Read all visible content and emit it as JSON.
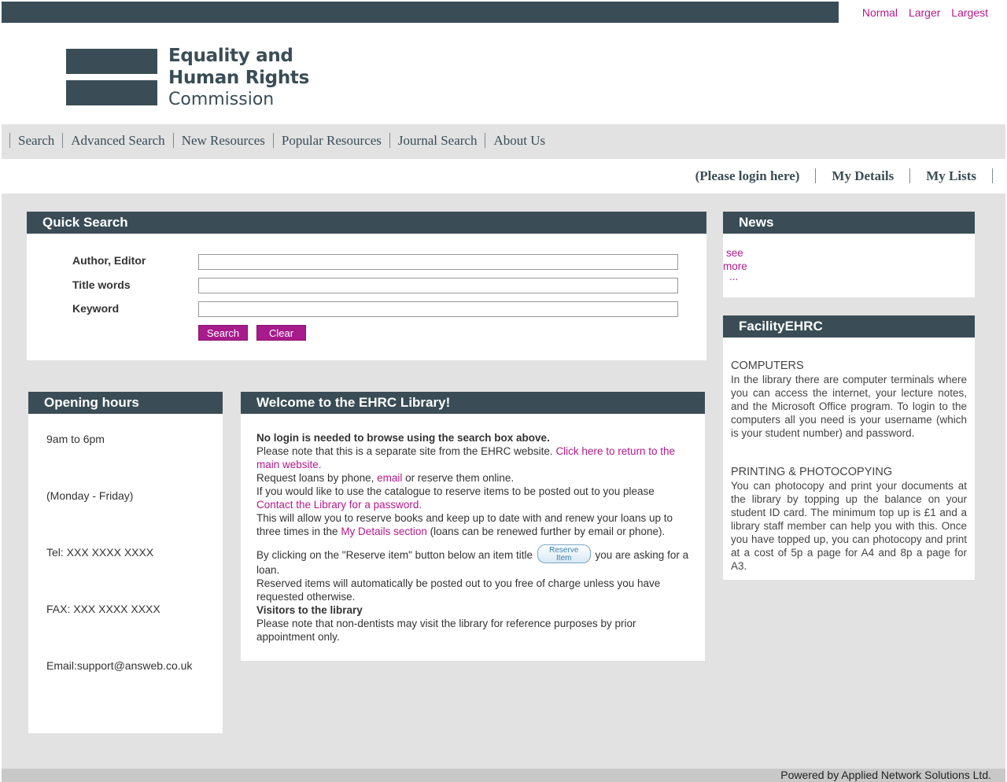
{
  "text_size": {
    "normal": "Normal",
    "larger": "Larger",
    "largest": "Largest"
  },
  "logo": {
    "line1": "Equality and",
    "line2": "Human Rights",
    "line3": "Commission"
  },
  "nav": [
    "Search",
    "Advanced Search",
    "New Resources",
    "Popular Resources",
    "Journal Search",
    "About Us"
  ],
  "user_nav": [
    "(Please login here)",
    "My Details",
    "My Lists"
  ],
  "quick_search": {
    "title": "Quick Search",
    "fields": [
      "Author, Editor",
      "Title words",
      "Keyword"
    ],
    "search_label": "Search",
    "clear_label": "Clear"
  },
  "news": {
    "title": "News",
    "see": "see",
    "more": "more",
    "ellipsis": "..."
  },
  "facility": {
    "title": "FacilityEHRC",
    "computers_heading": "COMPUTERS",
    "computers_text": "In the library there are computer terminals where you can access the internet, your lecture notes, and the Microsoft Office program. To login to the computers all you need is your username (which is your student number) and password.",
    "printing_heading": "PRINTING & PHOTOCOPYING",
    "printing_text": "You can photocopy and print your documents at the library by topping up the balance on your student ID card. The minimum top up is £1 and a library staff member can help you with this. Once you have topped up, you can photocopy and print at a cost of 5p a page for A4 and 8p a page for A3."
  },
  "hours": {
    "title": "Opening hours",
    "time": "9am to 6pm",
    "days": "(Monday - Friday)",
    "tel": "Tel: XXX XXXX XXXX",
    "fax": "FAX: XXX XXXX XXXX",
    "email": "Email:support@answeb.co.uk"
  },
  "welcome": {
    "title": "Welcome to the EHRC Library!",
    "bold1": "No login is needed to browse using the search box above.",
    "p1a": "Please note that this is a separate site from the EHRC website. ",
    "p1link": "Click here to return to the main website.",
    "p2a": "Request loans by phone, ",
    "p2link": "email",
    "p2b": " or reserve them online.",
    "p3a": "If you would like to use the catalogue to reserve items to be posted out to you please ",
    "p3link": "Contact the Library for a password.",
    "p4a": "This will allow you to reserve books and keep up to date with and renew your loans up to three times in the ",
    "p4link": "My Details section",
    "p4b": " (loans can be renewed further by email or phone).",
    "p5a": "By clicking on the \"Reserve item\" button below an item title ",
    "reserve_l1": "Reserve",
    "reserve_l2": "Item",
    "p5b": " you are asking for a loan.",
    "p6": "Reserved items will automatically be posted out to you free of charge unless you have requested otherwise.",
    "bold2": "Visitors to the library",
    "p7": "Please note that non-dentists may visit the library for reference purposes by prior appointment only."
  },
  "footer": "Powered by Applied Network Solutions Ltd."
}
